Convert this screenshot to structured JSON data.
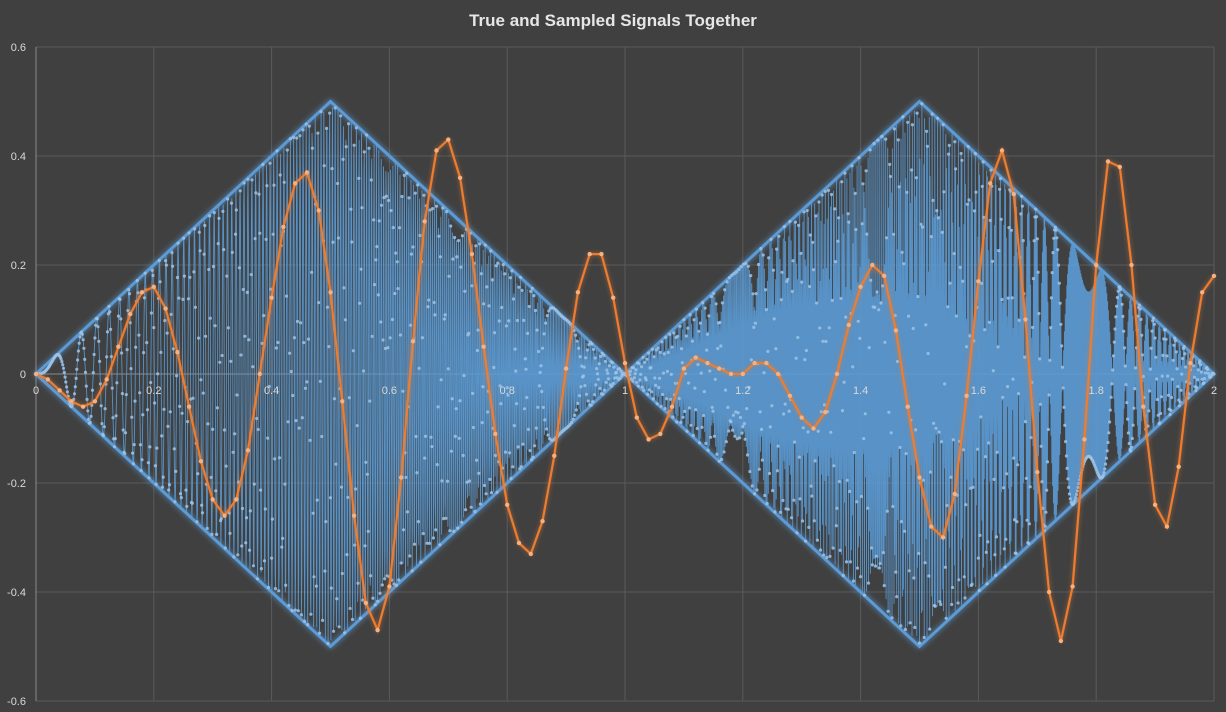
{
  "chart_data": {
    "type": "scatter",
    "title": "True and Sampled Signals Together",
    "xlabel": "",
    "ylabel": "",
    "xlim": [
      0,
      2
    ],
    "ylim": [
      -0.6,
      0.6
    ],
    "x_ticks": [
      0,
      0.2,
      0.4,
      0.6,
      0.8,
      1,
      1.2,
      1.4,
      1.6,
      1.8,
      2
    ],
    "x_tick_labels": [
      "0",
      "0.2",
      "0.4",
      "0.6",
      "0.8",
      "1",
      "1.2",
      "1.4",
      "1.6",
      "1.8",
      "2"
    ],
    "y_ticks": [
      -0.6,
      -0.4,
      -0.2,
      0,
      0.2,
      0.4,
      0.6
    ],
    "y_tick_labels": [
      "-0.6",
      "-0.4",
      "-0.2",
      "0",
      "0.2",
      "0.4",
      "0.6"
    ],
    "grid": true,
    "legend": "none",
    "series": [
      {
        "color": "#5b9bd5",
        "marker_color": "#9dc3e6",
        "style": "dense markers with line",
        "x": [
          0,
          0.05,
          0.1,
          0.15,
          0.2,
          0.25,
          0.3,
          0.35,
          0.4,
          0.45,
          0.5,
          0.55,
          0.6,
          0.65,
          0.7,
          0.75,
          0.8,
          0.85,
          0.9,
          0.95,
          1,
          1.05,
          1.1,
          1.15,
          1.2,
          1.25,
          1.3,
          1.35,
          1.4,
          1.45,
          1.5,
          1.55,
          1.6,
          1.65,
          1.7,
          1.75,
          1.8,
          1.85,
          1.9,
          1.95,
          2
        ],
        "envelope_upper": [
          0,
          0.05,
          0.1,
          0.15,
          0.2,
          0.25,
          0.3,
          0.35,
          0.4,
          0.45,
          0.5,
          0.45,
          0.4,
          0.35,
          0.3,
          0.25,
          0.2,
          0.15,
          0.1,
          0.05,
          0,
          0.05,
          0.1,
          0.15,
          0.2,
          0.25,
          0.3,
          0.35,
          0.4,
          0.45,
          0.5,
          0.45,
          0.4,
          0.35,
          0.3,
          0.25,
          0.2,
          0.15,
          0.1,
          0.05,
          0
        ],
        "envelope_lower": [
          0,
          -0.05,
          -0.1,
          -0.15,
          -0.2,
          -0.25,
          -0.3,
          -0.35,
          -0.4,
          -0.45,
          -0.5,
          -0.45,
          -0.4,
          -0.35,
          -0.3,
          -0.25,
          -0.2,
          -0.15,
          -0.1,
          -0.05,
          0,
          -0.05,
          -0.1,
          -0.15,
          -0.2,
          -0.25,
          -0.3,
          -0.35,
          -0.4,
          -0.45,
          -0.5,
          -0.45,
          -0.4,
          -0.35,
          -0.3,
          -0.25,
          -0.2,
          -0.15,
          -0.1,
          -0.05,
          0
        ]
      },
      {
        "color": "#ed7d31",
        "style": "line with markers",
        "x": [
          0,
          0.02,
          0.04,
          0.06,
          0.08,
          0.1,
          0.12,
          0.14,
          0.16,
          0.18,
          0.2,
          0.22,
          0.24,
          0.26,
          0.28,
          0.3,
          0.32,
          0.34,
          0.36,
          0.38,
          0.4,
          0.42,
          0.44,
          0.46,
          0.48,
          0.5,
          0.52,
          0.54,
          0.56,
          0.58,
          0.6,
          0.62,
          0.64,
          0.66,
          0.68,
          0.7,
          0.72,
          0.74,
          0.76,
          0.78,
          0.8,
          0.82,
          0.84,
          0.86,
          0.88,
          0.9,
          0.92,
          0.94,
          0.96,
          0.98,
          1,
          1.02,
          1.04,
          1.06,
          1.08,
          1.1,
          1.12,
          1.14,
          1.16,
          1.18,
          1.2,
          1.22,
          1.24,
          1.26,
          1.28,
          1.3,
          1.32,
          1.34,
          1.36,
          1.38,
          1.4,
          1.42,
          1.44,
          1.46,
          1.48,
          1.5,
          1.52,
          1.54,
          1.56,
          1.58,
          1.6,
          1.62,
          1.64,
          1.66,
          1.68,
          1.7,
          1.72,
          1.74,
          1.76,
          1.78,
          1.8,
          1.82,
          1.84,
          1.86,
          1.88,
          1.9,
          1.92,
          1.94,
          1.96,
          1.98,
          2
        ],
        "y": [
          0,
          -0.01,
          -0.03,
          -0.05,
          -0.06,
          -0.05,
          -0.01,
          0.05,
          0.11,
          0.15,
          0.16,
          0.12,
          0.04,
          -0.06,
          -0.16,
          -0.23,
          -0.26,
          -0.23,
          -0.14,
          0.0,
          0.14,
          0.27,
          0.35,
          0.37,
          0.3,
          0.15,
          -0.05,
          -0.26,
          -0.42,
          -0.47,
          -0.39,
          -0.19,
          0.06,
          0.28,
          0.41,
          0.43,
          0.36,
          0.22,
          0.05,
          -0.11,
          -0.24,
          -0.31,
          -0.33,
          -0.27,
          -0.15,
          0.01,
          0.15,
          0.22,
          0.22,
          0.14,
          0.02,
          -0.08,
          -0.12,
          -0.11,
          -0.06,
          0.01,
          0.03,
          0.02,
          0.01,
          0.0,
          0.0,
          0.02,
          0.02,
          0.0,
          -0.04,
          -0.08,
          -0.1,
          -0.07,
          0.0,
          0.09,
          0.16,
          0.2,
          0.18,
          0.08,
          -0.06,
          -0.19,
          -0.28,
          -0.3,
          -0.22,
          -0.04,
          0.17,
          0.35,
          0.41,
          0.33,
          0.1,
          -0.18,
          -0.4,
          -0.49,
          -0.39,
          -0.12,
          0.2,
          0.39,
          0.38,
          0.2,
          -0.06,
          -0.24,
          -0.28,
          -0.17,
          0.02,
          0.15,
          0.18
        ]
      }
    ]
  }
}
